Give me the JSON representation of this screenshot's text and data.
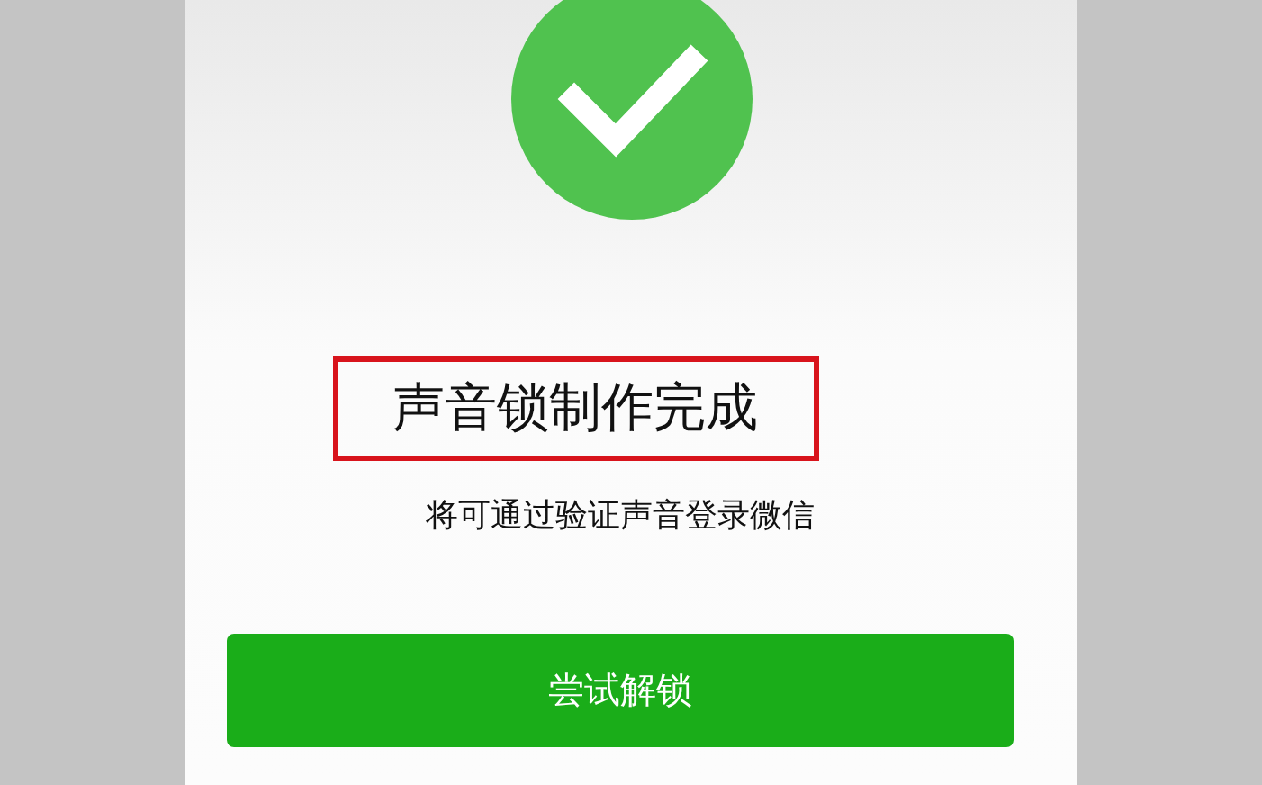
{
  "status_icon": {
    "kind": "success"
  },
  "title": {
    "text": "声音锁制作完成",
    "highlighted": true
  },
  "subtitle": "将可通过验证声音登录微信",
  "button": {
    "label": "尝试解锁"
  }
}
